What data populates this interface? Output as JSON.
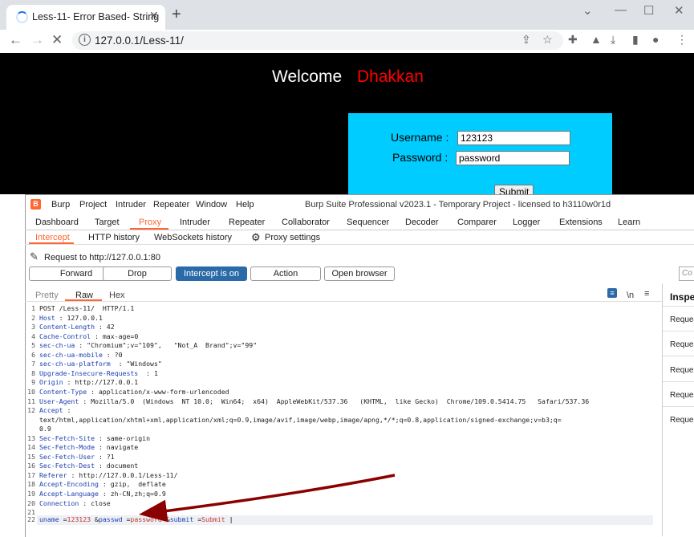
{
  "browser": {
    "tab_title": "Less-11- Error Based- String",
    "tab_close": "✕",
    "new_tab": "+",
    "url": "127.0.0.1/Less-11/"
  },
  "page": {
    "welcome": "Welcome",
    "name": "Dhakkan",
    "username_label": "Username :",
    "username_value": "123123",
    "password_label": "Password :",
    "password_value": "password",
    "submit": "Submit"
  },
  "burp": {
    "logo": "B",
    "menu": [
      "Burp",
      "Project",
      "Intruder",
      "Repeater",
      "Window",
      "Help"
    ],
    "title": "Burp Suite Professional v2023.1 - Temporary Project - licensed to h3110w0r1d",
    "tabs": [
      "Dashboard",
      "Target",
      "Proxy",
      "Intruder",
      "Repeater",
      "Collaborator",
      "Sequencer",
      "Decoder",
      "Comparer",
      "Logger",
      "Extensions",
      "Learn"
    ],
    "subtabs": [
      "Intercept",
      "HTTP history",
      "WebSockets history",
      "Proxy settings"
    ],
    "request_to": "Request to http://127.0.0.1:80",
    "buttons": [
      "Forward",
      "Drop",
      "Intercept is on",
      "Action",
      "Open browser"
    ],
    "comment_placeholder": "Co",
    "view_tabs": [
      "Pretty",
      "Raw",
      "Hex"
    ],
    "newline_toggle": "\\n",
    "inspector_title": "Inspe",
    "inspector_rows": [
      "Reques",
      "Reques",
      "Reques",
      "Reques",
      "Reques"
    ],
    "request_lines": [
      {
        "n": "1",
        "k": "",
        "v": "POST /Less-11/  HTTP/1.1"
      },
      {
        "n": "2",
        "k": "Host",
        "v": " : 127.0.0.1"
      },
      {
        "n": "3",
        "k": "Content-Length",
        "v": " : 42"
      },
      {
        "n": "4",
        "k": "Cache-Control",
        "v": " : max-age=0"
      },
      {
        "n": "5",
        "k": "sec-ch-ua",
        "v": " : \"Chromium\";v=\"109\",   \"Not_A  Brand\";v=\"99\""
      },
      {
        "n": "6",
        "k": "sec-ch-ua-mobile",
        "v": " : ?0"
      },
      {
        "n": "7",
        "k": "sec-ch-ua-platform",
        "v": "  : \"Windows\""
      },
      {
        "n": "8",
        "k": "Upgrade-Insecure-Requests",
        "v": "  : 1"
      },
      {
        "n": "9",
        "k": "Origin",
        "v": " : http://127.0.0.1"
      },
      {
        "n": "10",
        "k": "Content-Type",
        "v": " : application/x-www-form-urlencoded"
      },
      {
        "n": "11",
        "k": "User-Agent",
        "v": " : Mozilla/5.0  (Windows  NT 10.0;  Win64;  x64)  AppleWebKit/537.36   (KHTML,  like Gecko)  Chrome/109.0.5414.75   Safari/537.36"
      },
      {
        "n": "12",
        "k": "Accept",
        "v": " :"
      },
      {
        "n": "",
        "k": "",
        "v": "text/html,application/xhtml+xml,application/xml;q=0.9,image/avif,image/webp,image/apng,*/*;q=0.8,application/signed-exchange;v=b3;q="
      },
      {
        "n": "",
        "k": "",
        "v": "0.9"
      },
      {
        "n": "13",
        "k": "Sec-Fetch-Site",
        "v": " : same-origin"
      },
      {
        "n": "14",
        "k": "Sec-Fetch-Mode",
        "v": " : navigate"
      },
      {
        "n": "15",
        "k": "Sec-Fetch-User",
        "v": " : ?1"
      },
      {
        "n": "16",
        "k": "Sec-Fetch-Dest",
        "v": " : document"
      },
      {
        "n": "17",
        "k": "Referer",
        "v": " : http://127.0.0.1/Less-11/"
      },
      {
        "n": "18",
        "k": "Accept-Encoding",
        "v": " : gzip,  deflate"
      },
      {
        "n": "19",
        "k": "Accept-Language",
        "v": " : zh-CN,zh;q=0.9"
      },
      {
        "n": "20",
        "k": "Connection",
        "v": " : close"
      },
      {
        "n": "21",
        "k": "",
        "v": ""
      }
    ],
    "body_line": {
      "n": "22",
      "p1k": "uname",
      "p1v": "123123",
      "p2k": "passwd",
      "p2v": "password",
      "p3k": "submit",
      "p3v": "Submit"
    }
  },
  "colors": {
    "proxy_accent": "#ff6633",
    "intercept_on": "#2b6aa8",
    "login_box": "#00ccff",
    "welcome_name": "#ff0000",
    "arrow": "#8b0000"
  }
}
